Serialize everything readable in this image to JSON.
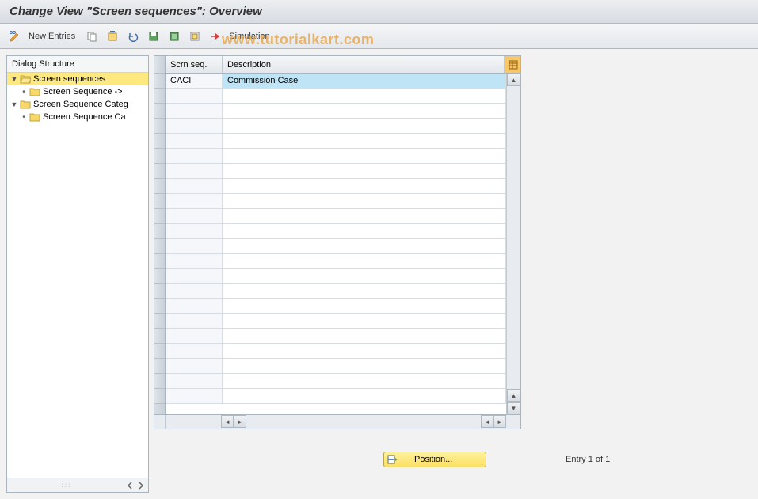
{
  "title": "Change View \"Screen sequences\": Overview",
  "watermark": "www.tutorialkart.com",
  "toolbar": {
    "new_entries_label": "New Entries",
    "simulation_label": "Simulation"
  },
  "dialog_structure": {
    "header": "Dialog Structure",
    "items": [
      {
        "label": "Screen sequences",
        "expanded": true,
        "selected": true,
        "open": true
      },
      {
        "label": "Screen Sequence ->",
        "child": true
      },
      {
        "label": "Screen Sequence Categ",
        "expanded": true
      },
      {
        "label": "Screen Sequence Ca",
        "child": true
      }
    ]
  },
  "table": {
    "col_seq": "Scrn seq.",
    "col_desc": "Description",
    "rows": [
      {
        "seq": "CACI",
        "desc": "Commission Case",
        "selected": true
      }
    ],
    "empty_rows": 21
  },
  "footer": {
    "position_label": "Position...",
    "entry_text": "Entry 1 of 1"
  }
}
